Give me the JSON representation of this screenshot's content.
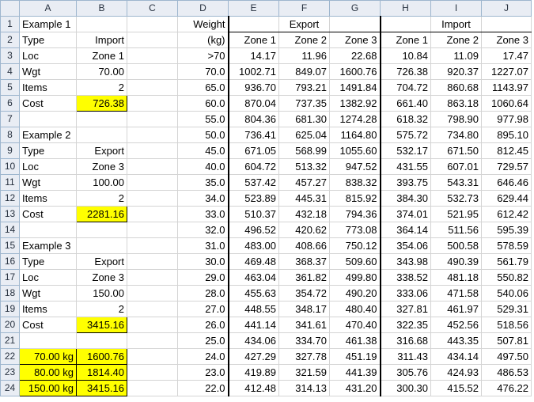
{
  "columns": [
    "A",
    "B",
    "C",
    "D",
    "E",
    "F",
    "G",
    "H",
    "I",
    "J"
  ],
  "rows": [
    {
      "n": "1",
      "A": "Example 1",
      "B": "",
      "C": "",
      "D": "Weight",
      "E": "",
      "F": "Export",
      "G": "",
      "H": "",
      "I": "Import",
      "J": ""
    },
    {
      "n": "2",
      "A": "Type",
      "B": "Import",
      "C": "",
      "D": "(kg)",
      "E": "Zone 1",
      "F": "Zone 2",
      "G": "Zone 3",
      "H": "Zone 1",
      "I": "Zone 2",
      "J": "Zone 3"
    },
    {
      "n": "3",
      "A": "Loc",
      "B": "Zone 1",
      "C": "",
      "D": ">70",
      "E": "14.17",
      "F": "11.96",
      "G": "22.68",
      "H": "10.84",
      "I": "11.09",
      "J": "17.47"
    },
    {
      "n": "4",
      "A": "Wgt",
      "B": "70.00",
      "C": "",
      "D": "70.0",
      "E": "1002.71",
      "F": "849.07",
      "G": "1600.76",
      "H": "726.38",
      "I": "920.37",
      "J": "1227.07"
    },
    {
      "n": "5",
      "A": "Items",
      "B": "2",
      "C": "",
      "D": "65.0",
      "E": "936.70",
      "F": "793.21",
      "G": "1491.84",
      "H": "704.72",
      "I": "860.68",
      "J": "1143.97"
    },
    {
      "n": "6",
      "A": "Cost",
      "B": "726.38",
      "C": "",
      "D": "60.0",
      "E": "870.04",
      "F": "737.35",
      "G": "1382.92",
      "H": "661.40",
      "I": "863.18",
      "J": "1060.64"
    },
    {
      "n": "7",
      "A": "",
      "B": "",
      "C": "",
      "D": "55.0",
      "E": "804.36",
      "F": "681.30",
      "G": "1274.28",
      "H": "618.32",
      "I": "798.90",
      "J": "977.98"
    },
    {
      "n": "8",
      "A": "Example 2",
      "B": "",
      "C": "",
      "D": "50.0",
      "E": "736.41",
      "F": "625.04",
      "G": "1164.80",
      "H": "575.72",
      "I": "734.80",
      "J": "895.10"
    },
    {
      "n": "9",
      "A": "Type",
      "B": "Export",
      "C": "",
      "D": "45.0",
      "E": "671.05",
      "F": "568.99",
      "G": "1055.60",
      "H": "532.17",
      "I": "671.50",
      "J": "812.45"
    },
    {
      "n": "10",
      "A": "Loc",
      "B": "Zone 3",
      "C": "",
      "D": "40.0",
      "E": "604.72",
      "F": "513.32",
      "G": "947.52",
      "H": "431.55",
      "I": "607.01",
      "J": "729.57"
    },
    {
      "n": "11",
      "A": "Wgt",
      "B": "100.00",
      "C": "",
      "D": "35.0",
      "E": "537.42",
      "F": "457.27",
      "G": "838.32",
      "H": "393.75",
      "I": "543.31",
      "J": "646.46"
    },
    {
      "n": "12",
      "A": "Items",
      "B": "2",
      "C": "",
      "D": "34.0",
      "E": "523.89",
      "F": "445.31",
      "G": "815.92",
      "H": "384.30",
      "I": "532.73",
      "J": "629.44"
    },
    {
      "n": "13",
      "A": "Cost",
      "B": "2281.16",
      "C": "",
      "D": "33.0",
      "E": "510.37",
      "F": "432.18",
      "G": "794.36",
      "H": "374.01",
      "I": "521.95",
      "J": "612.42"
    },
    {
      "n": "14",
      "A": "",
      "B": "",
      "C": "",
      "D": "32.0",
      "E": "496.52",
      "F": "420.62",
      "G": "773.08",
      "H": "364.14",
      "I": "511.56",
      "J": "595.39"
    },
    {
      "n": "15",
      "A": "Example 3",
      "B": "",
      "C": "",
      "D": "31.0",
      "E": "483.00",
      "F": "408.66",
      "G": "750.12",
      "H": "354.06",
      "I": "500.58",
      "J": "578.59"
    },
    {
      "n": "16",
      "A": "Type",
      "B": "Export",
      "C": "",
      "D": "30.0",
      "E": "469.48",
      "F": "368.37",
      "G": "509.60",
      "H": "343.98",
      "I": "490.39",
      "J": "561.79"
    },
    {
      "n": "17",
      "A": "Loc",
      "B": "Zone 3",
      "C": "",
      "D": "29.0",
      "E": "463.04",
      "F": "361.82",
      "G": "499.80",
      "H": "338.52",
      "I": "481.18",
      "J": "550.82"
    },
    {
      "n": "18",
      "A": "Wgt",
      "B": "150.00",
      "C": "",
      "D": "28.0",
      "E": "455.63",
      "F": "354.72",
      "G": "490.20",
      "H": "333.06",
      "I": "471.58",
      "J": "540.06"
    },
    {
      "n": "19",
      "A": "Items",
      "B": "2",
      "C": "",
      "D": "27.0",
      "E": "448.55",
      "F": "348.17",
      "G": "480.40",
      "H": "327.81",
      "I": "461.97",
      "J": "529.31"
    },
    {
      "n": "20",
      "A": "Cost",
      "B": "3415.16",
      "C": "",
      "D": "26.0",
      "E": "441.14",
      "F": "341.61",
      "G": "470.40",
      "H": "322.35",
      "I": "452.56",
      "J": "518.56"
    },
    {
      "n": "21",
      "A": "",
      "B": "",
      "C": "",
      "D": "25.0",
      "E": "434.06",
      "F": "334.70",
      "G": "461.38",
      "H": "316.68",
      "I": "443.35",
      "J": "507.81"
    },
    {
      "n": "22",
      "A": "70.00 kg",
      "B": "1600.76",
      "C": "",
      "D": "24.0",
      "E": "427.29",
      "F": "327.78",
      "G": "451.19",
      "H": "311.43",
      "I": "434.14",
      "J": "497.50"
    },
    {
      "n": "23",
      "A": "80.00 kg",
      "B": "1814.40",
      "C": "",
      "D": "23.0",
      "E": "419.89",
      "F": "321.59",
      "G": "441.39",
      "H": "305.76",
      "I": "424.93",
      "J": "486.53"
    },
    {
      "n": "24",
      "A": "150.00 kg",
      "B": "3415.16",
      "C": "",
      "D": "22.0",
      "E": "412.48",
      "F": "314.13",
      "G": "431.20",
      "H": "300.30",
      "I": "415.52",
      "J": "476.22"
    }
  ],
  "colors": {
    "highlight": "#ffff00",
    "header_bg": "#e9edf4"
  }
}
